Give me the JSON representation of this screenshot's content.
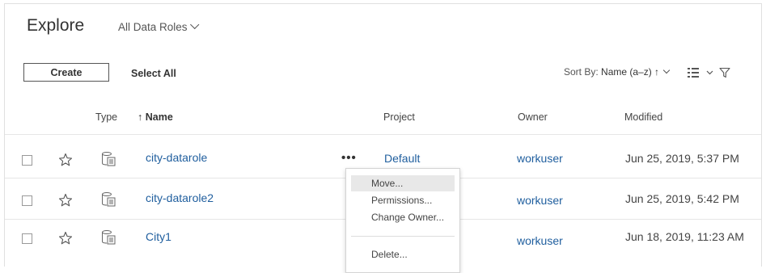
{
  "header": {
    "title": "Explore",
    "role_filter": "All Data Roles"
  },
  "toolbar": {
    "create_label": "Create",
    "select_all_label": "Select All",
    "sort_by_label": "Sort By:",
    "sort_by_value": "Name (a–z) ↑"
  },
  "columns": {
    "type": "Type",
    "name": "↑ Name",
    "project": "Project",
    "owner": "Owner",
    "modified": "Modified"
  },
  "rows": [
    {
      "name": "city-datarole",
      "project": "Default",
      "owner": "workuser",
      "modified": "Jun 25, 2019, 5:37 PM"
    },
    {
      "name": "city-datarole2",
      "project": "",
      "owner": "workuser",
      "modified": "Jun 25, 2019, 5:42 PM"
    },
    {
      "name": "City1",
      "project": "",
      "owner": "workuser",
      "modified": "Jun 18, 2019, 11:23 AM"
    }
  ],
  "actions_label": "•••",
  "context_menu": {
    "items": [
      "Move...",
      "Permissions...",
      "Change Owner...",
      "Delete..."
    ],
    "highlighted": "Move..."
  },
  "icons": {
    "star": "star-outline-icon",
    "type": "data-role-icon",
    "view": "list-view-icon",
    "filter": "filter-icon"
  }
}
